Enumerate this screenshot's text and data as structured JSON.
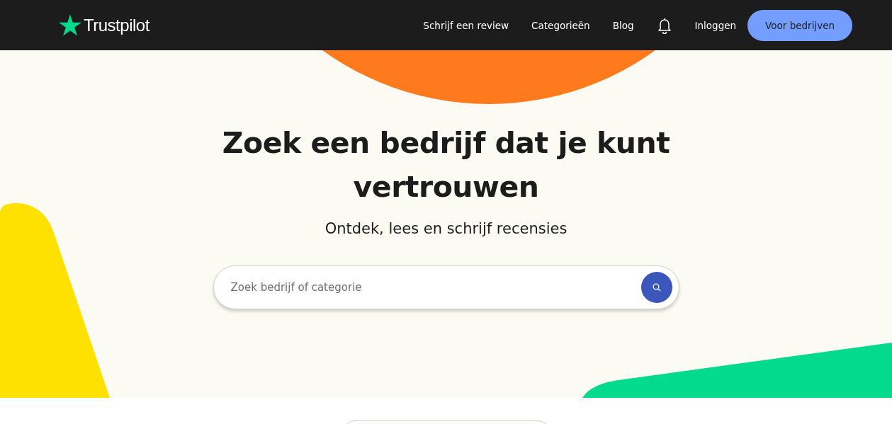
{
  "header": {
    "logo": "Trustpilot",
    "nav": [
      "Schrijf een review",
      "Categorieën",
      "Blog"
    ],
    "login": "Inloggen",
    "cta": "Voor bedrijven"
  },
  "hero": {
    "title": "Zoek een bedrijf dat je kunt vertrouwen",
    "subtitle": "Ontdek, lees en schrijf recensies"
  },
  "search": {
    "placeholder": "Zoek bedrijf of categorie"
  }
}
